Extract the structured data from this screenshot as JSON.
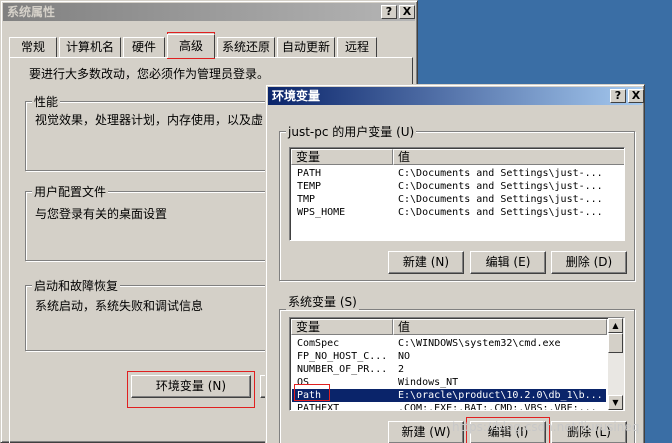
{
  "sys_props": {
    "title": "系统属性",
    "tabs": [
      "常规",
      "计算机名",
      "硬件",
      "高级",
      "系统还原",
      "自动更新",
      "远程"
    ],
    "admin_note": "要进行大多数改动，您必须作为管理员登录。",
    "perf_title": "性能",
    "perf_desc": "视觉效果，处理器计划，内存使用，以及虚",
    "profile_title": "用户配置文件",
    "profile_desc": "与您登录有关的桌面设置",
    "startup_title": "启动和故障恢复",
    "startup_desc": "系统启动，系统失败和调试信息",
    "env_button": "环境变量 (N)"
  },
  "env_vars": {
    "title": "环境变量",
    "user_group": "just-pc 的用户变量 (U)",
    "col_var": "变量",
    "col_value": "值",
    "user_rows": [
      {
        "name": "PATH",
        "value": "C:\\Documents and Settings\\just-..."
      },
      {
        "name": "TEMP",
        "value": "C:\\Documents and Settings\\just-..."
      },
      {
        "name": "TMP",
        "value": "C:\\Documents and Settings\\just-..."
      },
      {
        "name": "WPS_HOME",
        "value": "C:\\Documents and Settings\\just-..."
      }
    ],
    "user_new": "新建 (N)",
    "user_edit": "编辑 (E)",
    "user_delete": "删除 (D)",
    "sys_group": "系统变量 (S)",
    "sys_rows": [
      {
        "name": "ComSpec",
        "value": "C:\\WINDOWS\\system32\\cmd.exe"
      },
      {
        "name": "FP_NO_HOST_C...",
        "value": "NO"
      },
      {
        "name": "NUMBER_OF_PR...",
        "value": "2"
      },
      {
        "name": "OS",
        "value": "Windows_NT"
      },
      {
        "name": "Path",
        "value": "E:\\oracle\\product\\10.2.0\\db_1\\b..."
      },
      {
        "name": "PATHEXT",
        "value": ".COM;.EXE;.BAT;.CMD;.VBS;.VBE;..."
      }
    ],
    "sys_new": "新建 (W)",
    "sys_edit": "编辑 (I)",
    "sys_delete": "删除 (L)"
  },
  "titlebar_help": "?",
  "titlebar_close": "X",
  "scroll_up": "▲",
  "scroll_down": "▼",
  "watermark": "https://blog.csdn.net/liurusineq"
}
